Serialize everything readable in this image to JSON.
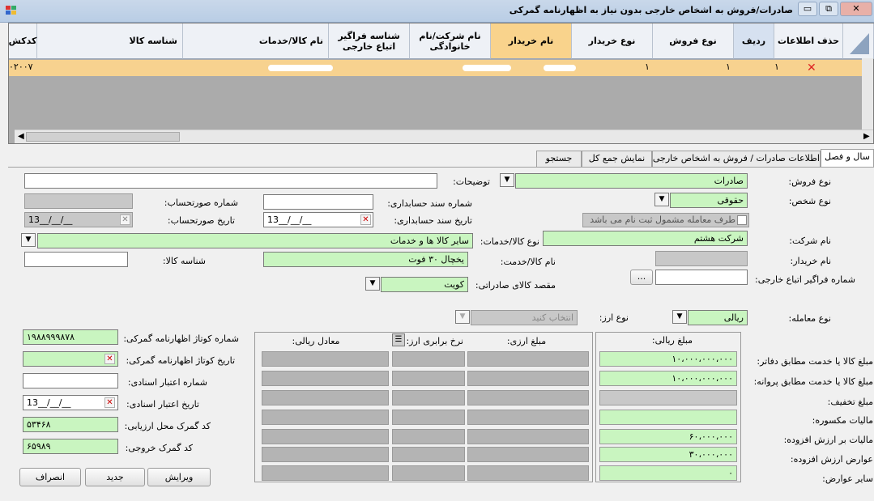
{
  "window": {
    "title": "صادرات/فروش به اشخاص خارجی بدون نیاز به اظهارنامه گمرکی",
    "min": "▭",
    "restore": "⧉",
    "close": "✕"
  },
  "grid": {
    "headers": [
      "حذف اطلاعات",
      "ردیف",
      "نوع فروش",
      "نوع خریدار",
      "نام خریدار",
      "نام شرکت/نام خانوادگی",
      "شناسه فراگیر اتباع خارجی",
      "نام کالا/خدمات",
      "شناسه کالا",
      "کدکش"
    ],
    "row": {
      "radif": "۱",
      "sale_type": "۱",
      "buyer_type": "۱",
      "code": "۰۲۰۰۷"
    }
  },
  "tabs": [
    "سال و فصل",
    "اطلاعات صادرات / فروش به اشخاص خارجی",
    "نمایش جمع کل",
    "جستجو"
  ],
  "form": {
    "sale_type_label": "نوع فروش:",
    "sale_type": "صادرات",
    "desc_label": "توضیحات:",
    "desc": "",
    "person_type_label": "نوع شخص:",
    "person_type": "حقوقی",
    "acc_doc_no_label": "شماره سند حسابداری:",
    "invoice_no_label": "شماره صورتحساب:",
    "acc_doc_date_label": "تاریخ سند حسابداری:",
    "acc_doc_date": "13__/__/__",
    "invoice_date_label": "تاریخ صورتحساب:",
    "invoice_date": "13__/__/__",
    "registered_party_label": "طرف معامله مشمول ثبت نام می باشد",
    "company_label": "نام شرکت:",
    "company": "شرکت هشتم",
    "goods_type_label": "نوع کالا/خدمات:",
    "goods_type": "سایر کالا ها و خدمات",
    "buyer_name_label": "نام خریدار:",
    "goods_name_label": "نام کالا/خدمت:",
    "goods_name": "یخچال ۳۰ فوت",
    "goods_id_label": "شناسه کالا:",
    "foreign_id_label": "شماره فراگیر اتباع خارجی:",
    "browse": "...",
    "destination_label": "مقصد کالای صادراتی:",
    "destination": "کویت",
    "deal_type_label": "نوع معامله:",
    "deal_type": "ریالی",
    "currency_type_label": "نوع ارز:",
    "currency_type": "انتخاب کنید",
    "customs_no_label": "شماره کوتاژ اظهارنامه گمرکی:",
    "customs_no": "۱۹۸۸۹۹۹۸۷۸",
    "customs_date_label": "تاریخ کوتاژ اظهارنامه گمرکی:",
    "credit_no_label": "شماره اعتبار اسنادی:",
    "credit_date_label": "تاریخ اعتبار اسنادی:",
    "credit_date": "13__/__/__",
    "customs_code_label": "کد گمرک محل ارزیابی:",
    "customs_code": "۵۳۴۶۸",
    "exit_code_label": "کد گمرک خروجی:",
    "exit_code": "۶۵۹۸۹"
  },
  "amounts": {
    "rial_header": "مبلغ ریالی:",
    "fx_header": "مبلغ ارزی:",
    "rate_header": "نرخ برابری ارز:",
    "rial_eq_header": "معادل ریالی:",
    "rows": [
      {
        "label": "مبلغ کالا یا خدمت مطابق دفاتر:",
        "value": "۱۰،۰۰۰،۰۰۰،۰۰۰"
      },
      {
        "label": "مبلغ کالا یا خدمت مطابق پروانه:",
        "value": "۱۰،۰۰۰،۰۰۰،۰۰۰"
      },
      {
        "label": "مبلغ تخفیف:",
        "value": ""
      },
      {
        "label": "مالیات مکسوره:",
        "value": ""
      },
      {
        "label": "مالیات بر ارزش افزوده:",
        "value": "۶۰،۰۰۰،۰۰۰"
      },
      {
        "label": "عوارض ارزش افزوده:",
        "value": "۳۰،۰۰۰،۰۰۰"
      },
      {
        "label": "سایر عوارض:",
        "value": "۰"
      }
    ]
  },
  "buttons": {
    "edit": "ویرایش",
    "new": "جدید",
    "cancel": "انصراف"
  }
}
